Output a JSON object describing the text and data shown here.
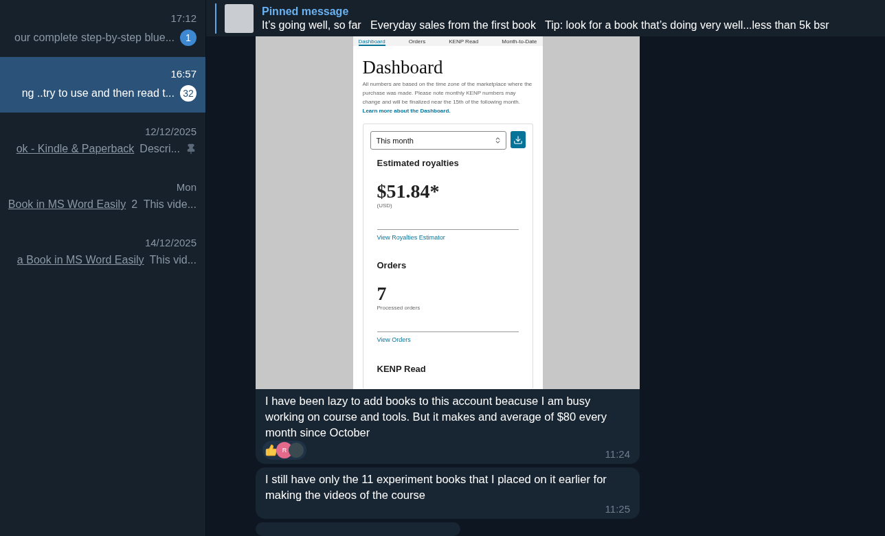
{
  "sidebar": {
    "chats": [
      {
        "time": "17:12",
        "text": "our complete step-by-step blue...",
        "badge": "1",
        "pinned": false,
        "selected": false
      },
      {
        "time": "16:57",
        "text": "ng ..try to use and then read t...",
        "badge": "32",
        "pinned": false,
        "selected": true
      },
      {
        "time": "12/12/2025",
        "link": "ok - Kindle & Paperback",
        "text": "Descri...",
        "pinned": true,
        "selected": false
      },
      {
        "time": "Mon",
        "link": "Book in MS Word Easily",
        "text": "2  This vide...",
        "pinned": false,
        "selected": false
      },
      {
        "time": "14/12/2025",
        "link": "a Book in MS Word Easily",
        "text": "This vid...",
        "pinned": false,
        "selected": false
      }
    ]
  },
  "pinned": {
    "title": "Pinned message",
    "text": "It’s going well, so far   Everyday sales from the first book   Tip: look for a book that’s doing very well...less than 5k bsr"
  },
  "screenshot": {
    "tabs": [
      {
        "label": "Dashboard",
        "selected": true
      },
      {
        "label": "Orders",
        "selected": false
      },
      {
        "label": "KENP Read",
        "selected": false
      },
      {
        "label": "Month-to-Date",
        "selected": false
      }
    ],
    "heading": "Dashboard",
    "intro": "All numbers are based on the time zone of the marketplace where the purchase was made. Please note monthly KENP numbers may change and will be finalized near the 15th of the following month.",
    "intro_link": "Learn more about the Dashboard.",
    "period": "This month",
    "royalties_title": "Estimated royalties",
    "royalties": "$51.84*",
    "currency": "(USD)",
    "royalties_link": "View Royalties Estimator",
    "orders_title": "Orders",
    "orders": "7",
    "orders_caption": "Processed orders",
    "orders_link": "View Orders",
    "kenp_title": "KENP Read"
  },
  "messages": [
    {
      "text": "I have been lazy to add books to this account beacuse I am busy working on course and tools. But it makes and average of $80 every month since October",
      "time": "11:24",
      "reactions": true,
      "avatar_letter": "R"
    },
    {
      "text": "I still have only the 11 experiment books that I placed on it earlier for making the videos of the course",
      "time": "11:25",
      "reactions": false
    }
  ]
}
